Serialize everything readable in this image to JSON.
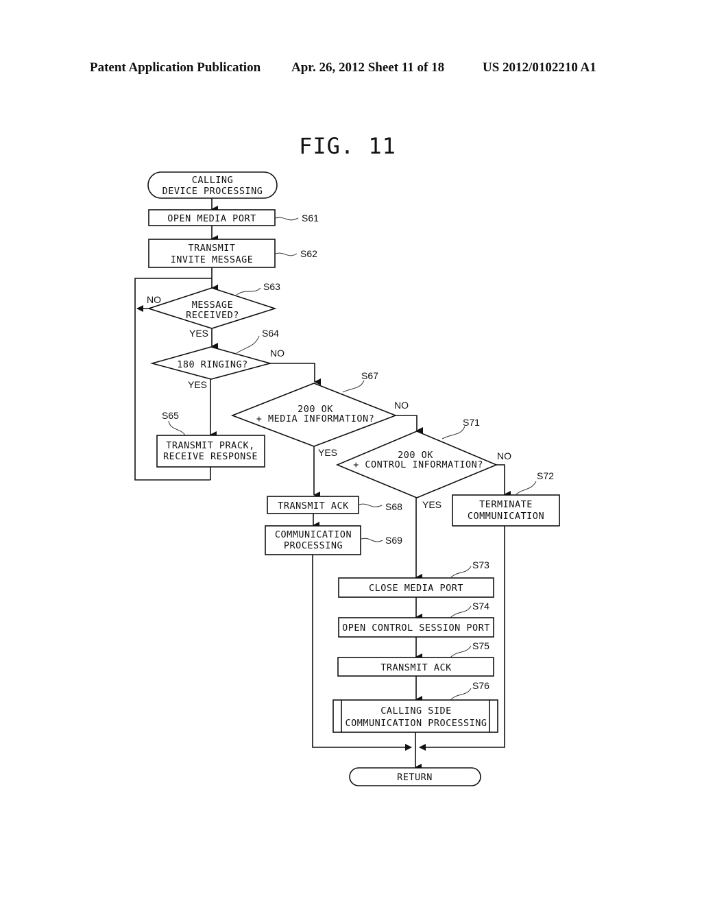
{
  "header": {
    "publication": "Patent Application Publication",
    "date_sheet": "Apr. 26, 2012  Sheet 11 of 18",
    "number": "US 2012/0102210 A1"
  },
  "figure": {
    "title": "FIG. 11",
    "start": [
      "CALLING",
      "DEVICE PROCESSING"
    ],
    "end": "RETURN",
    "steps": {
      "s61": {
        "id": "S61",
        "lines": [
          "OPEN MEDIA PORT"
        ]
      },
      "s62": {
        "id": "S62",
        "lines": [
          "TRANSMIT",
          "INVITE MESSAGE"
        ]
      },
      "s63": {
        "id": "S63",
        "lines": [
          "MESSAGE",
          "RECEIVED?"
        ]
      },
      "s64": {
        "id": "S64",
        "lines": [
          "180 RINGING?"
        ]
      },
      "s65": {
        "id": "S65",
        "lines": [
          "TRANSMIT PRACK,",
          "RECEIVE RESPONSE"
        ]
      },
      "s67": {
        "id": "S67",
        "lines": [
          "200 OK",
          "+ MEDIA INFORMATION?"
        ]
      },
      "s68": {
        "id": "S68",
        "lines": [
          "TRANSMIT ACK"
        ]
      },
      "s69": {
        "id": "S69",
        "lines": [
          "COMMUNICATION",
          "PROCESSING"
        ]
      },
      "s71": {
        "id": "S71",
        "lines": [
          "200 OK",
          "+ CONTROL INFORMATION?"
        ]
      },
      "s72": {
        "id": "S72",
        "lines": [
          "TERMINATE",
          "COMMUNICATION"
        ]
      },
      "s73": {
        "id": "S73",
        "lines": [
          "CLOSE MEDIA PORT"
        ]
      },
      "s74": {
        "id": "S74",
        "lines": [
          "OPEN CONTROL SESSION PORT"
        ]
      },
      "s75": {
        "id": "S75",
        "lines": [
          "TRANSMIT ACK"
        ]
      },
      "s76": {
        "id": "S76",
        "lines": [
          "CALLING SIDE",
          "COMMUNICATION PROCESSING"
        ]
      }
    },
    "branch_labels": {
      "yes": "YES",
      "no": "NO"
    }
  }
}
